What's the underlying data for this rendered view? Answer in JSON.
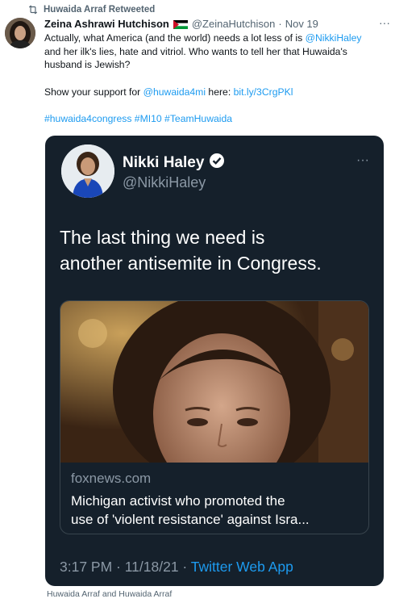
{
  "retweet": {
    "label": "Huwaida Arraf Retweeted"
  },
  "tweet": {
    "author_name": "Zeina Ashrawi Hutchison",
    "handle": "@ZeinaHutchison",
    "separator": "·",
    "date": "Nov 19",
    "more_label": "···",
    "line1_a": "Actually, what America (and the world) needs a lot less of is ",
    "line1_link": "@NikkiHaley",
    "line2": "and her ilk's lies, hate and vitriol. Who wants to tell her that Huwaida's",
    "line3": "husband is Jewish?",
    "line4_a": "Show your support for ",
    "line4_link1": "@huwaida4mi",
    "line4_b": " here: ",
    "line4_link2": "bit.ly/3CrgPKl",
    "hashtags": "#huwaida4congress #MI10 #TeamHuwaida"
  },
  "quote": {
    "name": "Nikki Haley",
    "handle": "@NikkiHaley",
    "more_label": "···",
    "text_line1": "The last thing we need is",
    "text_line2": "another antisemite in Congress.",
    "article_domain": "foxnews.com",
    "article_title_line1": "Michigan activist who promoted the",
    "article_title_line2": "use of 'violent resistance' against Isra...",
    "time": "3:17 PM · 11/18/21 · ",
    "app": "Twitter Web App"
  },
  "caption": "Huwaida Arraf and Huwaida Arraf",
  "colors": {
    "link": "#1d9bf0",
    "card_bg": "#15202b",
    "muted": "#536471",
    "verified": "#1d9bf0"
  }
}
